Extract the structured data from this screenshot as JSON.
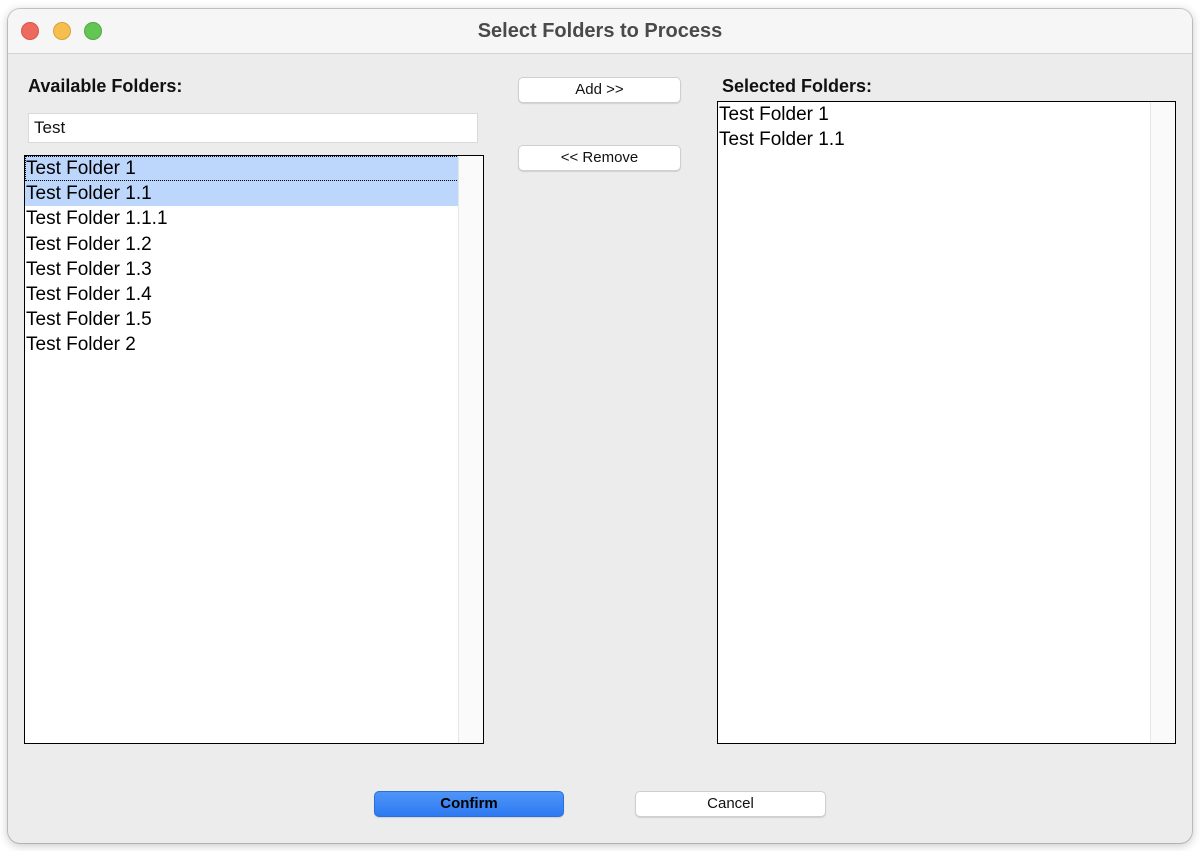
{
  "window": {
    "title": "Select Folders to Process"
  },
  "available": {
    "label": "Available Folders:",
    "search_value": "Test",
    "items": [
      {
        "label": "Test Folder 1",
        "selected": true,
        "focused": true
      },
      {
        "label": "Test Folder 1.1",
        "selected": true,
        "focused": false
      },
      {
        "label": "Test Folder 1.1.1",
        "selected": false,
        "focused": false
      },
      {
        "label": "Test Folder 1.2",
        "selected": false,
        "focused": false
      },
      {
        "label": "Test Folder 1.3",
        "selected": false,
        "focused": false
      },
      {
        "label": "Test Folder 1.4",
        "selected": false,
        "focused": false
      },
      {
        "label": "Test Folder 1.5",
        "selected": false,
        "focused": false
      },
      {
        "label": "Test Folder 2",
        "selected": false,
        "focused": false
      }
    ]
  },
  "selected": {
    "label": "Selected Folders:",
    "items": [
      {
        "label": "Test Folder 1"
      },
      {
        "label": "Test Folder 1.1"
      }
    ]
  },
  "actions": {
    "add_label": "Add >>",
    "remove_label": "<< Remove",
    "confirm_label": "Confirm",
    "cancel_label": "Cancel"
  },
  "colors": {
    "selection": "#bcd7fb",
    "primary_button": "#2d7af2",
    "close": "#ee6a5f",
    "minimize": "#f5be4f",
    "maximize": "#62c554"
  }
}
